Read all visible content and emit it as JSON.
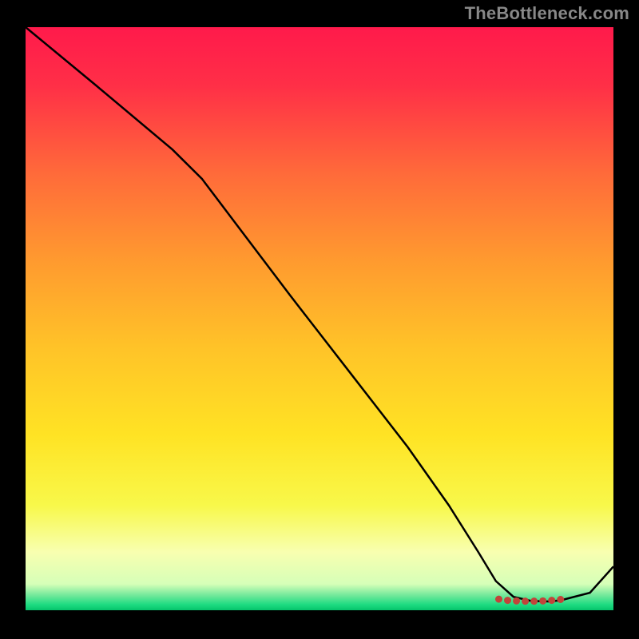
{
  "watermark": "TheBottleneck.com",
  "chart_data": {
    "type": "line",
    "title": "",
    "xlabel": "",
    "ylabel": "",
    "xlim": [
      0,
      100
    ],
    "ylim": [
      0,
      100
    ],
    "background_gradient": [
      {
        "stop": 0.0,
        "color": "#ff1a4b"
      },
      {
        "stop": 0.1,
        "color": "#ff2f47"
      },
      {
        "stop": 0.25,
        "color": "#ff6a3a"
      },
      {
        "stop": 0.4,
        "color": "#ff9a2f"
      },
      {
        "stop": 0.55,
        "color": "#ffc328"
      },
      {
        "stop": 0.7,
        "color": "#ffe324"
      },
      {
        "stop": 0.82,
        "color": "#f8f84a"
      },
      {
        "stop": 0.9,
        "color": "#f8ffb0"
      },
      {
        "stop": 0.955,
        "color": "#d6ffb8"
      },
      {
        "stop": 0.975,
        "color": "#6fe89a"
      },
      {
        "stop": 0.99,
        "color": "#1fdc82"
      },
      {
        "stop": 1.0,
        "color": "#05c46b"
      }
    ],
    "series": [
      {
        "name": "curve",
        "color": "#000000",
        "width": 2.5,
        "x": [
          0,
          12,
          25,
          30,
          36,
          45,
          55,
          65,
          72,
          77,
          80,
          83,
          86,
          89,
          91,
          96,
          100
        ],
        "y": [
          100,
          90,
          79,
          74,
          66,
          54,
          41,
          28,
          18,
          10,
          5,
          2.3,
          1.6,
          1.5,
          1.7,
          3.0,
          7.5
        ]
      }
    ],
    "markers": {
      "name": "flat-segment-dots",
      "color": "#c1443a",
      "radius": 4.5,
      "x": [
        80.5,
        82.0,
        83.5,
        85.0,
        86.5,
        88.0,
        89.5,
        91.0
      ],
      "y": [
        1.9,
        1.7,
        1.6,
        1.55,
        1.55,
        1.6,
        1.7,
        1.85
      ]
    }
  }
}
